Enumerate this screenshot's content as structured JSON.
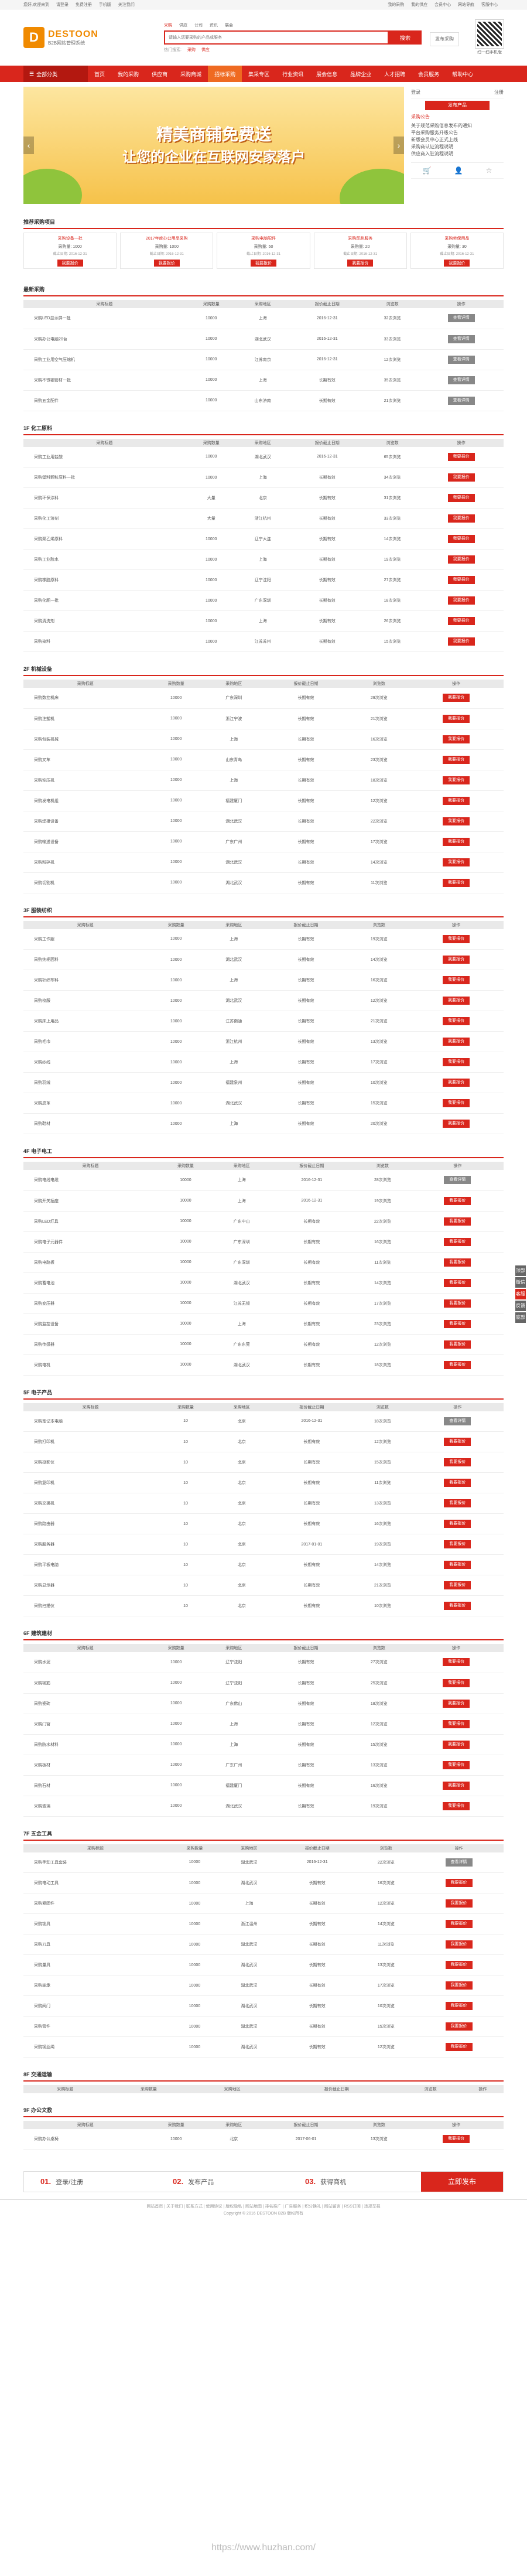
{
  "topbar": {
    "left": [
      "您好,欢迎来到",
      "请登录",
      "免费注册",
      "手机版",
      "关注我们"
    ],
    "right": [
      "我的采购",
      "我的供应",
      "会员中心",
      "网站导航",
      "客服中心"
    ]
  },
  "logo": {
    "mark": "D",
    "name": "DESTOON",
    "sub": "B2B网站管理系统"
  },
  "search": {
    "tabs": [
      "采购",
      "供应",
      "公司",
      "资讯",
      "展会"
    ],
    "placeholder": "请输入您要采购的产品或服务",
    "button": "搜索",
    "hot_label": "热门搜索:",
    "hot": [
      "采购",
      "供应"
    ],
    "publish": "发布采购"
  },
  "qr": {
    "label": "扫一扫手机版"
  },
  "nav": {
    "all": "全部分类",
    "items": [
      "首页",
      "我的采购",
      "供应商",
      "采购商城",
      "招标采购",
      "集采专区",
      "行业资讯",
      "展会信息",
      "品牌企业",
      "人才招聘",
      "会员服务",
      "帮助中心"
    ],
    "active": 4
  },
  "banner": {
    "line1": "精美商铺免费送",
    "line2": "让您的企业在互联网安家落户"
  },
  "side": {
    "login_tab": "登录",
    "reg_tab": "注册",
    "pub": "发布产品",
    "notice_title": "采购公告",
    "notices": [
      "关于规范采购信息发布的通知",
      "平台采购服务升级公告",
      "新版会员中心正式上线",
      "采购商认证流程说明",
      "供应商入驻流程说明"
    ],
    "icons": [
      "cart-icon",
      "user-icon",
      "star-icon"
    ]
  },
  "featured": {
    "title": "推荐采购项目",
    "cards": [
      {
        "title": "采购设备一批",
        "qty": "采购量: 1000",
        "date": "截止日期: 2016-12-31",
        "btn": "我要报价"
      },
      {
        "title": "2017年度办公用品采购",
        "qty": "采购量: 1000",
        "date": "截止日期: 2016-12-31",
        "btn": "我要报价"
      },
      {
        "title": "采购电脑配件",
        "qty": "采购量: 50",
        "date": "截止日期: 2016-12-31",
        "btn": "我要报价"
      },
      {
        "title": "采购印刷服务",
        "qty": "采购量: 20",
        "date": "截止日期: 2016-12-31",
        "btn": "我要报价"
      },
      {
        "title": "采购劳保用品",
        "qty": "采购量: 30",
        "date": "截止日期: 2016-12-31",
        "btn": "我要报价"
      }
    ]
  },
  "table_headers": [
    "采购标题",
    "采购数量",
    "采购地区",
    "报价截止日期",
    "浏览数",
    "操作"
  ],
  "sections": [
    {
      "title": "最新采购",
      "rows": [
        [
          "采购LED显示屏一批",
          "10000",
          "上海",
          "2016-12-31",
          "32次浏览",
          "查看详情",
          "g"
        ],
        [
          "采购办公电脑20台",
          "10000",
          "湖北武汉",
          "2016-12-31",
          "33次浏览",
          "查看详情",
          "g"
        ],
        [
          "采购工业用空气压缩机",
          "10000",
          "江苏南京",
          "2016-12-31",
          "12次浏览",
          "查看详情",
          "g"
        ],
        [
          "采购不锈钢管材一批",
          "10000",
          "上海",
          "长期有效",
          "35次浏览",
          "查看详情",
          "g"
        ],
        [
          "采购五金配件",
          "10000",
          "山东济南",
          "长期有效",
          "21次浏览",
          "查看详情",
          "g"
        ]
      ]
    },
    {
      "title": "1F 化工原料",
      "rows": [
        [
          "采购工业用盐酸",
          "10000",
          "湖北武汉",
          "2016-12-31",
          "65次浏览",
          "我要报价",
          "r"
        ],
        [
          "采购塑料颗粒原料一批",
          "10000",
          "上海",
          "长期有效",
          "34次浏览",
          "我要报价",
          "r"
        ],
        [
          "采购环保涂料",
          "大量",
          "北京",
          "长期有效",
          "31次浏览",
          "我要报价",
          "r"
        ],
        [
          "采购化工溶剂",
          "大量",
          "浙江杭州",
          "长期有效",
          "33次浏览",
          "我要报价",
          "r"
        ],
        [
          "采购聚乙烯原料",
          "10000",
          "辽宁大连",
          "长期有效",
          "14次浏览",
          "我要报价",
          "r"
        ],
        [
          "采购工业胶水",
          "10000",
          "上海",
          "长期有效",
          "19次浏览",
          "我要报价",
          "r"
        ],
        [
          "采购橡胶原料",
          "10000",
          "辽宁沈阳",
          "长期有效",
          "27次浏览",
          "我要报价",
          "r"
        ],
        [
          "采购化肥一批",
          "10000",
          "广东深圳",
          "长期有效",
          "18次浏览",
          "我要报价",
          "r"
        ],
        [
          "采购清洗剂",
          "10000",
          "上海",
          "长期有效",
          "26次浏览",
          "我要报价",
          "r"
        ],
        [
          "采购染料",
          "10000",
          "江苏苏州",
          "长期有效",
          "15次浏览",
          "我要报价",
          "r"
        ]
      ]
    },
    {
      "title": "2F 机械设备",
      "rows": [
        [
          "采购数控机床",
          "10000",
          "广东深圳",
          "长期有效",
          "29次浏览",
          "我要报价",
          "r"
        ],
        [
          "采购注塑机",
          "10000",
          "浙江宁波",
          "长期有效",
          "21次浏览",
          "我要报价",
          "r"
        ],
        [
          "采购包装机械",
          "10000",
          "上海",
          "长期有效",
          "16次浏览",
          "我要报价",
          "r"
        ],
        [
          "采购叉车",
          "10000",
          "山东青岛",
          "长期有效",
          "23次浏览",
          "我要报价",
          "r"
        ],
        [
          "采购空压机",
          "10000",
          "上海",
          "长期有效",
          "18次浏览",
          "我要报价",
          "r"
        ],
        [
          "采购发电机组",
          "10000",
          "福建厦门",
          "长期有效",
          "12次浏览",
          "我要报价",
          "r"
        ],
        [
          "采购焊接设备",
          "10000",
          "湖北武汉",
          "长期有效",
          "22次浏览",
          "我要报价",
          "r"
        ],
        [
          "采购输送设备",
          "10000",
          "广东广州",
          "长期有效",
          "17次浏览",
          "我要报价",
          "r"
        ],
        [
          "采购粉碎机",
          "10000",
          "湖北武汉",
          "长期有效",
          "14次浏览",
          "我要报价",
          "r"
        ],
        [
          "采购切割机",
          "10000",
          "湖北武汉",
          "长期有效",
          "11次浏览",
          "我要报价",
          "r"
        ]
      ]
    },
    {
      "title": "3F 服装纺织",
      "rows": [
        [
          "采购工作服",
          "10000",
          "上海",
          "长期有效",
          "19次浏览",
          "我要报价",
          "r"
        ],
        [
          "采购纯棉面料",
          "10000",
          "湖北武汉",
          "长期有效",
          "14次浏览",
          "我要报价",
          "r"
        ],
        [
          "采购针织布料",
          "10000",
          "上海",
          "长期有效",
          "16次浏览",
          "我要报价",
          "r"
        ],
        [
          "采购校服",
          "10000",
          "湖北武汉",
          "长期有效",
          "12次浏览",
          "我要报价",
          "r"
        ],
        [
          "采购床上用品",
          "10000",
          "江苏南通",
          "长期有效",
          "21次浏览",
          "我要报价",
          "r"
        ],
        [
          "采购毛巾",
          "10000",
          "浙江杭州",
          "长期有效",
          "13次浏览",
          "我要报价",
          "r"
        ],
        [
          "采购纱线",
          "10000",
          "上海",
          "长期有效",
          "17次浏览",
          "我要报价",
          "r"
        ],
        [
          "采购羽绒",
          "10000",
          "福建泉州",
          "长期有效",
          "10次浏览",
          "我要报价",
          "r"
        ],
        [
          "采购皮革",
          "10000",
          "湖北武汉",
          "长期有效",
          "15次浏览",
          "我要报价",
          "r"
        ],
        [
          "采购鞋材",
          "10000",
          "上海",
          "长期有效",
          "20次浏览",
          "我要报价",
          "r"
        ]
      ]
    },
    {
      "title": "4F 电子电工",
      "rows": [
        [
          "采购电线电缆",
          "10000",
          "上海",
          "2016-12-31",
          "28次浏览",
          "查看详情",
          "g"
        ],
        [
          "采购开关插座",
          "10000",
          "上海",
          "2016-12-31",
          "19次浏览",
          "我要报价",
          "r"
        ],
        [
          "采购LED灯具",
          "10000",
          "广东中山",
          "长期有效",
          "22次浏览",
          "我要报价",
          "r"
        ],
        [
          "采购电子元器件",
          "10000",
          "广东深圳",
          "长期有效",
          "16次浏览",
          "我要报价",
          "r"
        ],
        [
          "采购电路板",
          "10000",
          "广东深圳",
          "长期有效",
          "11次浏览",
          "我要报价",
          "r"
        ],
        [
          "采购蓄电池",
          "10000",
          "湖北武汉",
          "长期有效",
          "14次浏览",
          "我要报价",
          "r"
        ],
        [
          "采购变压器",
          "10000",
          "江苏无锡",
          "长期有效",
          "17次浏览",
          "我要报价",
          "r"
        ],
        [
          "采购监控设备",
          "10000",
          "上海",
          "长期有效",
          "23次浏览",
          "我要报价",
          "r"
        ],
        [
          "采购传感器",
          "10000",
          "广东东莞",
          "长期有效",
          "12次浏览",
          "我要报价",
          "r"
        ],
        [
          "采购电机",
          "10000",
          "湖北武汉",
          "长期有效",
          "18次浏览",
          "我要报价",
          "r"
        ]
      ]
    },
    {
      "title": "5F 电子产品",
      "rows": [
        [
          "采购笔记本电脑",
          "10",
          "北京",
          "2016-12-31",
          "18次浏览",
          "查看详情",
          "g"
        ],
        [
          "采购打印机",
          "10",
          "北京",
          "长期有效",
          "12次浏览",
          "我要报价",
          "r"
        ],
        [
          "采购投影仪",
          "10",
          "北京",
          "长期有效",
          "15次浏览",
          "我要报价",
          "r"
        ],
        [
          "采购复印机",
          "10",
          "北京",
          "长期有效",
          "11次浏览",
          "我要报价",
          "r"
        ],
        [
          "采购交换机",
          "10",
          "北京",
          "长期有效",
          "13次浏览",
          "我要报价",
          "r"
        ],
        [
          "采购路由器",
          "10",
          "北京",
          "长期有效",
          "16次浏览",
          "我要报价",
          "r"
        ],
        [
          "采购服务器",
          "10",
          "北京",
          "2017-01-01",
          "19次浏览",
          "我要报价",
          "r"
        ],
        [
          "采购平板电脑",
          "10",
          "北京",
          "长期有效",
          "14次浏览",
          "我要报价",
          "r"
        ],
        [
          "采购显示器",
          "10",
          "北京",
          "长期有效",
          "21次浏览",
          "我要报价",
          "r"
        ],
        [
          "采购扫描仪",
          "10",
          "北京",
          "长期有效",
          "10次浏览",
          "我要报价",
          "r"
        ]
      ]
    },
    {
      "title": "6F 建筑建材",
      "rows": [
        [
          "采购水泥",
          "10000",
          "辽宁沈阳",
          "长期有效",
          "27次浏览",
          "我要报价",
          "r"
        ],
        [
          "采购钢筋",
          "10000",
          "辽宁沈阳",
          "长期有效",
          "25次浏览",
          "我要报价",
          "r"
        ],
        [
          "采购瓷砖",
          "10000",
          "广东佛山",
          "长期有效",
          "18次浏览",
          "我要报价",
          "r"
        ],
        [
          "采购门窗",
          "10000",
          "上海",
          "长期有效",
          "12次浏览",
          "我要报价",
          "r"
        ],
        [
          "采购防水材料",
          "10000",
          "上海",
          "长期有效",
          "15次浏览",
          "我要报价",
          "r"
        ],
        [
          "采购板材",
          "10000",
          "广东广州",
          "长期有效",
          "13次浏览",
          "我要报价",
          "r"
        ],
        [
          "采购石材",
          "10000",
          "福建厦门",
          "长期有效",
          "16次浏览",
          "我要报价",
          "r"
        ],
        [
          "采购玻璃",
          "10000",
          "湖北武汉",
          "长期有效",
          "19次浏览",
          "我要报价",
          "r"
        ]
      ]
    },
    {
      "title": "7F 五金工具",
      "rows": [
        [
          "采购手动工具套装",
          "10000",
          "湖北武汉",
          "2016-12-31",
          "22次浏览",
          "查看详情",
          "g"
        ],
        [
          "采购电动工具",
          "10000",
          "湖北武汉",
          "长期有效",
          "16次浏览",
          "我要报价",
          "r"
        ],
        [
          "采购紧固件",
          "10000",
          "上海",
          "长期有效",
          "12次浏览",
          "我要报价",
          "r"
        ],
        [
          "采购锁具",
          "10000",
          "浙江温州",
          "长期有效",
          "14次浏览",
          "我要报价",
          "r"
        ],
        [
          "采购刀具",
          "10000",
          "湖北武汉",
          "长期有效",
          "11次浏览",
          "我要报价",
          "r"
        ],
        [
          "采购量具",
          "10000",
          "湖北武汉",
          "长期有效",
          "13次浏览",
          "我要报价",
          "r"
        ],
        [
          "采购轴承",
          "10000",
          "湖北武汉",
          "长期有效",
          "17次浏览",
          "我要报价",
          "r"
        ],
        [
          "采购阀门",
          "10000",
          "湖北武汉",
          "长期有效",
          "10次浏览",
          "我要报价",
          "r"
        ],
        [
          "采购管件",
          "10000",
          "湖北武汉",
          "长期有效",
          "15次浏览",
          "我要报价",
          "r"
        ],
        [
          "采购钢丝绳",
          "10000",
          "湖北武汉",
          "长期有效",
          "12次浏览",
          "我要报价",
          "r"
        ]
      ]
    },
    {
      "title": "8F 交通运输",
      "rows": []
    },
    {
      "title": "9F 办公文教",
      "rows": [
        [
          "采购办公桌椅",
          "10000",
          "北京",
          "2017-06-01",
          "13次浏览",
          "我要报价",
          "r"
        ]
      ]
    }
  ],
  "steps": {
    "items": [
      {
        "num": "01.",
        "label": "登录/注册"
      },
      {
        "num": "02.",
        "label": "发布产品"
      },
      {
        "num": "03.",
        "label": "获得商机"
      }
    ],
    "go": "立即发布"
  },
  "footer": {
    "line1": "网站首页 | 关于我们 | 联系方式 | 使用协议 | 版权隐私 | 网站地图 | 排名推广 | 广告服务 | 积分换礼 | 网站留言 | RSS订阅 | 违规举报",
    "line2": "Copyright © 2016 DESTOON B2B 版权所有"
  },
  "floatbar": [
    "顶部",
    "微信",
    "客服",
    "反馈",
    "底部"
  ],
  "watermark": "https://www.huzhan.com/"
}
